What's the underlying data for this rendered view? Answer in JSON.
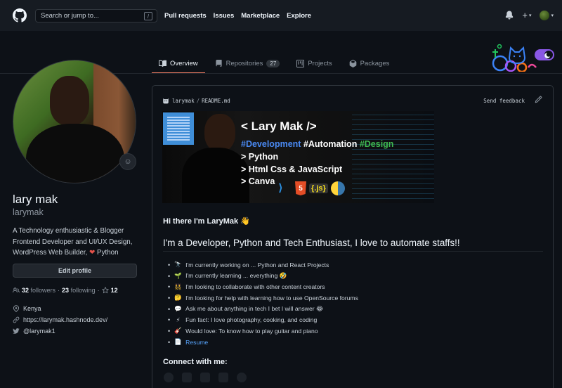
{
  "header": {
    "search_placeholder": "Search or jump to...",
    "search_shortcut": "/",
    "nav": [
      "Pull requests",
      "Issues",
      "Marketplace",
      "Explore"
    ],
    "plus": "+",
    "caret": "▾"
  },
  "tabs": [
    {
      "label": "Overview",
      "active": true
    },
    {
      "label": "Repositories",
      "count": "27"
    },
    {
      "label": "Projects"
    },
    {
      "label": "Packages"
    }
  ],
  "profile": {
    "name": "lary mak",
    "login": "larymak",
    "bio_line1": "A Technology enthusiastic & Blogger",
    "bio_line2": "Frontend Developer and UI/UX Design,",
    "bio_line3": "WordPress Web Builder,",
    "bio_heart": "❤",
    "bio_line3_end": "Python",
    "edit_button": "Edit profile",
    "followers_count": "32",
    "followers_label": "followers",
    "dot": "·",
    "following_count": "23",
    "following_label": "following",
    "stars_sep": "·",
    "stars_count": "12",
    "location": "Kenya",
    "website": "https://larymak.hashnode.dev/",
    "twitter": "@larymak1",
    "emoji_button": "☺"
  },
  "readme": {
    "owner": "larymak",
    "sep": "/",
    "file": "README.md",
    "feedback": "Send feedback",
    "banner": {
      "title": "< Lary Mak />",
      "line1_blue": "#Development",
      "line1_white": "#Automation",
      "line1_green": "#Design",
      "line2": "> Python",
      "line3": "> Html Css & JavaScript",
      "line4": "> Canva",
      "icon_vs": "⟩",
      "icon_html": "5",
      "icon_js": "{.js}"
    },
    "greeting": "Hi there I'm LaryMak 👋",
    "headline": "I'm a Developer, Python and Tech Enthusiast, I love to automate staffs!!",
    "items": [
      {
        "emoji": "🔭",
        "text": "I'm currently working on ... Python and React Projects"
      },
      {
        "emoji": "🌱",
        "text": "I'm currently learning ... everything 🤣"
      },
      {
        "emoji": "👯",
        "text": "I'm looking to collaborate with other content creators"
      },
      {
        "emoji": "🤔",
        "text": "I'm looking for help with learning how to use OpenSource forums"
      },
      {
        "emoji": "💬",
        "text": "Ask me about anything in tech I bet I will answer 😂"
      },
      {
        "emoji": "⚡",
        "text": "Fun fact: I love photography, cooking, and coding"
      },
      {
        "emoji": "🎸",
        "text": "Would love: To know how to play guitar and piano"
      },
      {
        "emoji": "📄",
        "text": "",
        "link": "Resume"
      }
    ],
    "connect": "Connect with me:"
  }
}
